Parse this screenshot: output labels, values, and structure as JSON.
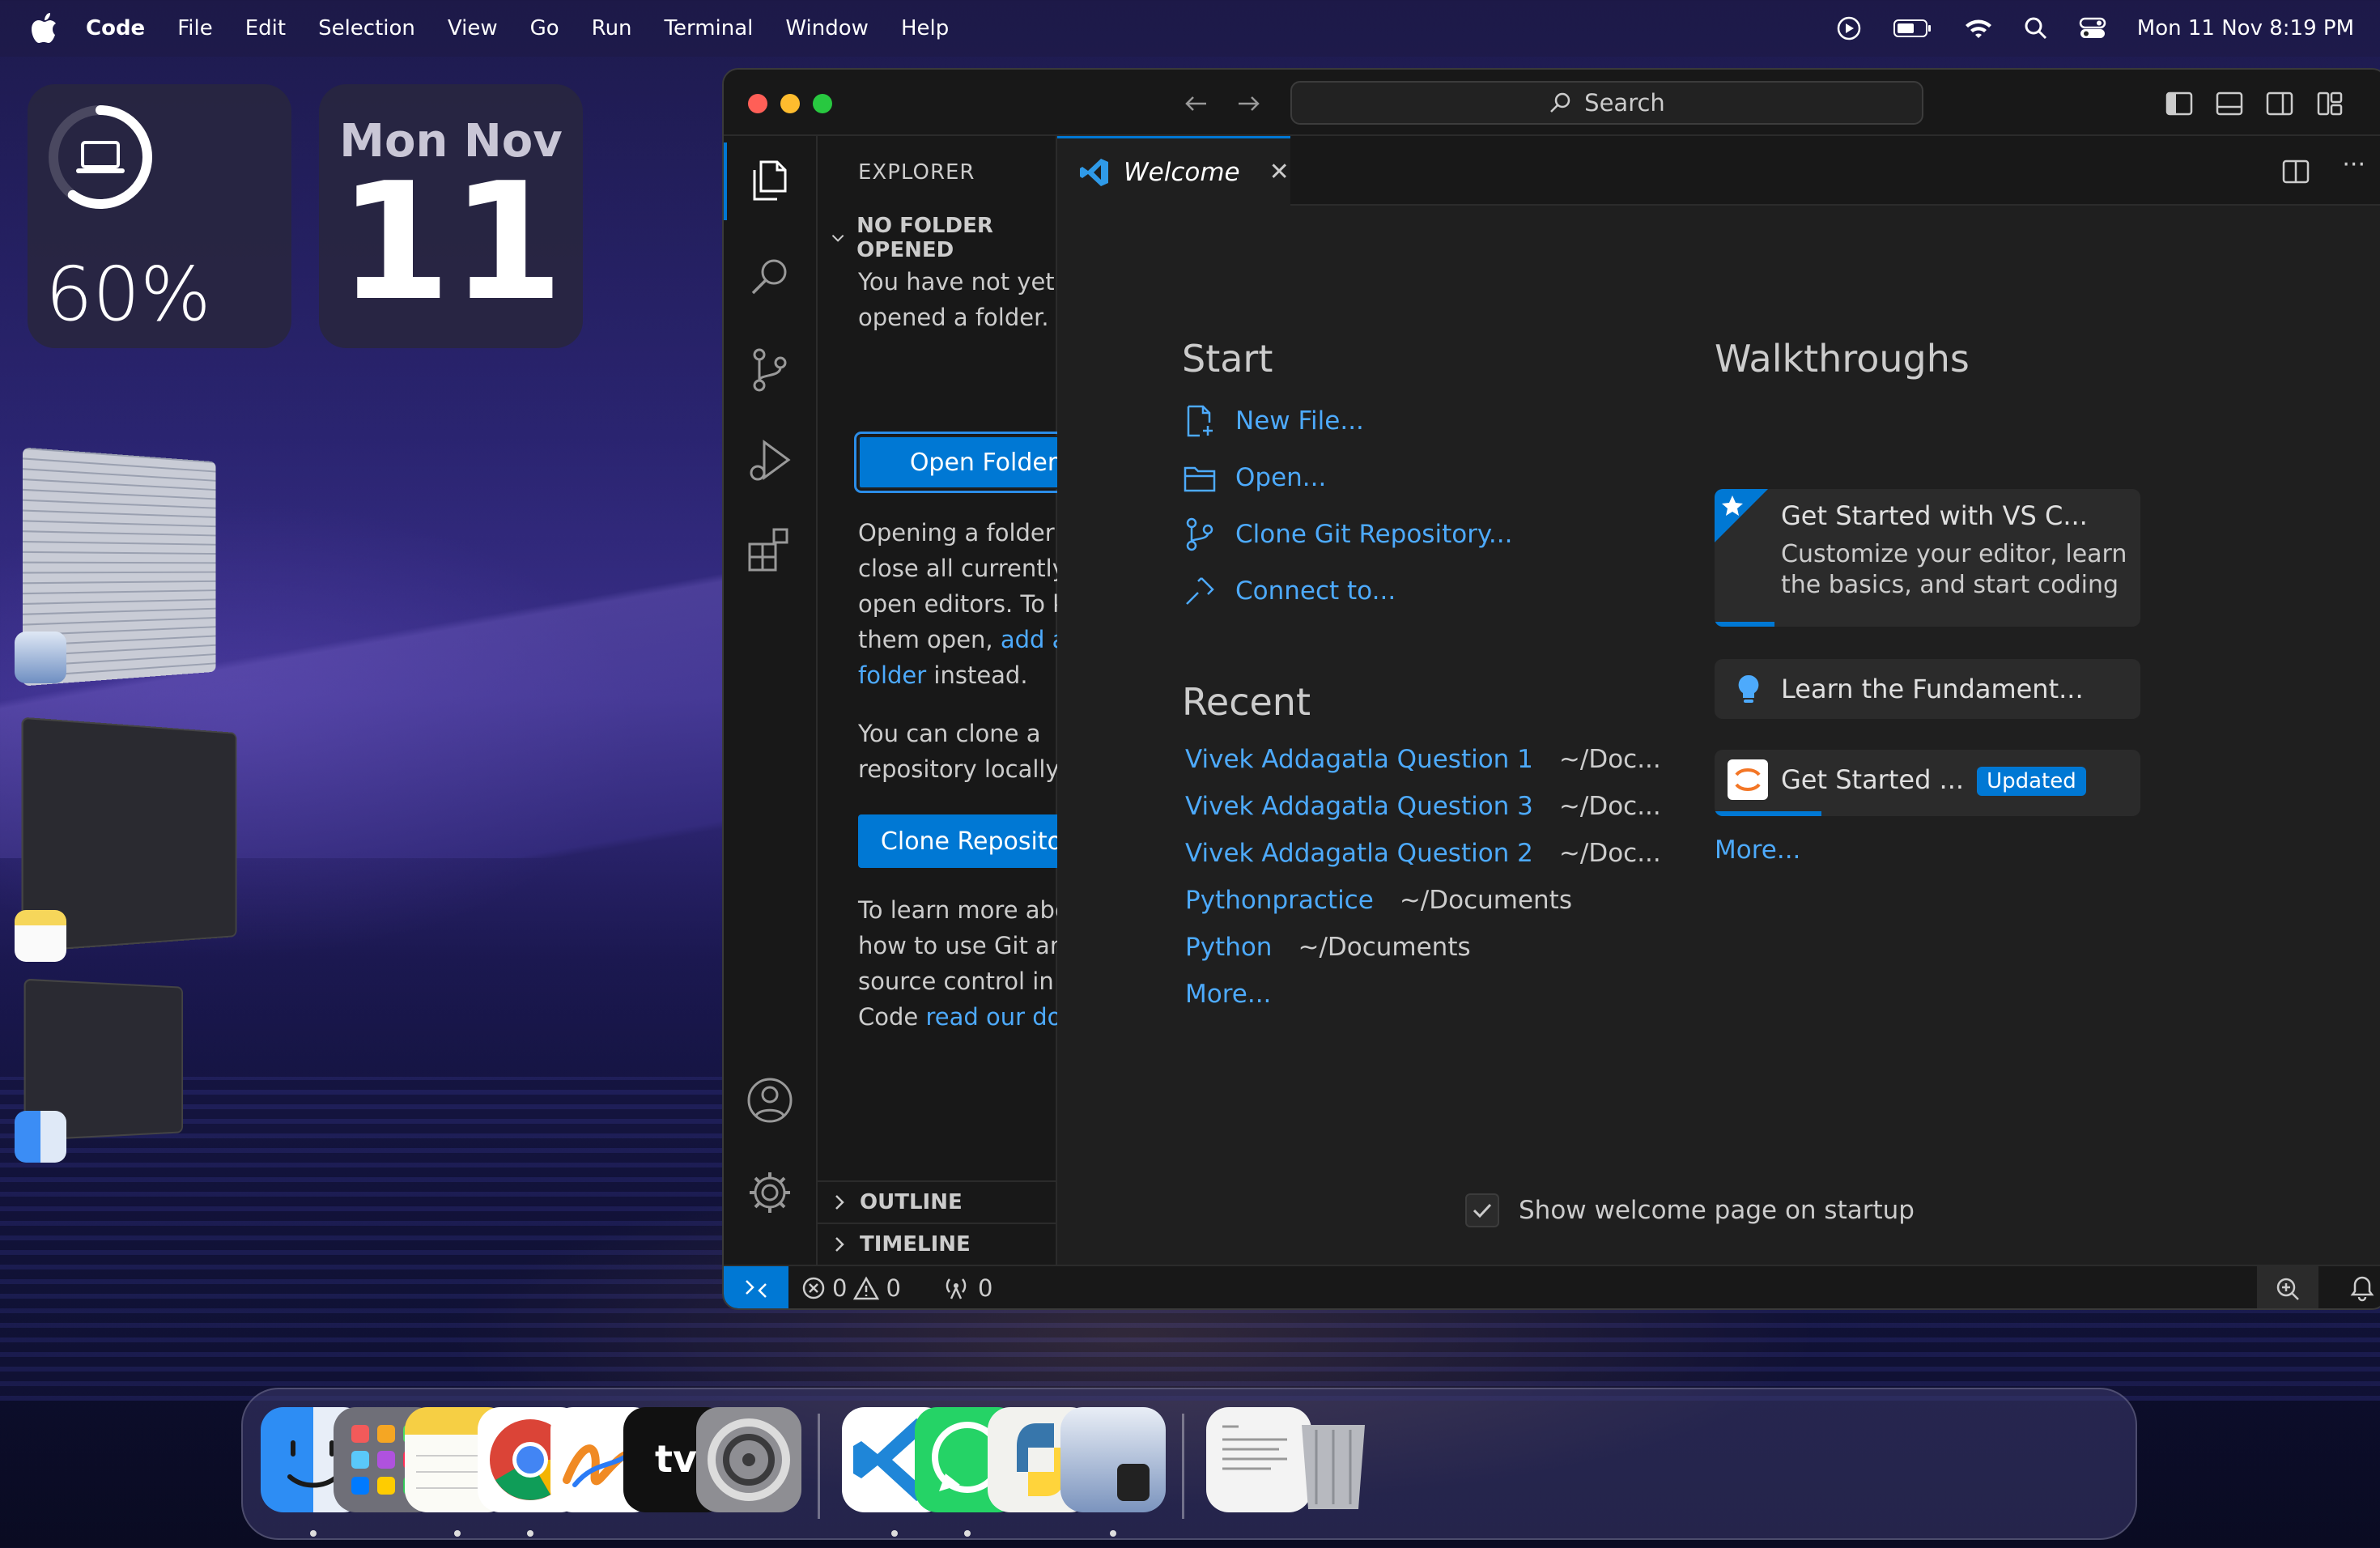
{
  "menubar": {
    "app_name": "Code",
    "menus": [
      "File",
      "Edit",
      "Selection",
      "View",
      "Go",
      "Run",
      "Terminal",
      "Window",
      "Help"
    ],
    "clock": "Mon 11 Nov  8:19 PM"
  },
  "widgets": {
    "battery": {
      "percent_label": "60%",
      "level": 0.6
    },
    "calendar": {
      "weekday_month": "Mon Nov",
      "day": "11"
    }
  },
  "vscode": {
    "search_label": "Search",
    "sidebar": {
      "title": "EXPLORER",
      "more": "···",
      "section_no_folder": "NO FOLDER OPENED",
      "text_not_opened": "You have not yet opened a folder.",
      "open_folder_button": "Open Folder",
      "text_opening_1": "Opening a folder will close all currently open editors. To keep them open,",
      "link_add_folder": "add a folder",
      "text_opening_2": "instead.",
      "text_clone": "You can clone a repository locally.",
      "clone_button": "Clone Repository",
      "text_learn_1": "To learn more about how to use Git and source control in VS Code",
      "link_docs": "read our docs",
      "text_learn_2": ".",
      "section_outline": "OUTLINE",
      "section_timeline": "TIMELINE"
    },
    "tab": {
      "label": "Welcome",
      "close": "✕"
    },
    "welcome": {
      "start_heading": "Start",
      "start_items": [
        {
          "label": "New File...",
          "icon": "new-file-icon"
        },
        {
          "label": "Open...",
          "icon": "folder-icon"
        },
        {
          "label": "Clone Git Repository...",
          "icon": "git-branch-icon"
        },
        {
          "label": "Connect to...",
          "icon": "remote-icon"
        }
      ],
      "recent_heading": "Recent",
      "recent": [
        {
          "name": "Vivek Addagatla Question 1",
          "path": "~/Doc..."
        },
        {
          "name": "Vivek Addagatla Question 3",
          "path": "~/Doc..."
        },
        {
          "name": "Vivek Addagatla Question 2",
          "path": "~/Doc..."
        },
        {
          "name": "Pythonpractice",
          "path": "~/Documents"
        },
        {
          "name": "Python",
          "path": "~/Documents"
        }
      ],
      "recent_more": "More...",
      "walkthroughs_heading": "Walkthroughs",
      "walkthroughs": [
        {
          "title": "Get Started with VS C...",
          "description": "Customize your editor, learn the basics, and start coding",
          "progress": 0.14
        },
        {
          "title": "Learn the Fundament...",
          "progress": 0
        },
        {
          "title": "Get Started ...",
          "badge": "Updated",
          "progress": 0.25
        }
      ],
      "walkthroughs_more": "More...",
      "show_on_startup": "Show welcome page on startup",
      "show_on_startup_checked": true
    },
    "statusbar": {
      "errors": "0",
      "warnings": "0",
      "ports": "0"
    }
  },
  "dock": {
    "apps": [
      "Finder",
      "Launchpad",
      "Notes",
      "Google Chrome",
      "Freeform",
      "Apple TV",
      "System Settings",
      "Visual Studio Code",
      "WhatsApp",
      "Python Launcher",
      "Preview",
      "Documents",
      "Trash"
    ]
  },
  "colors": {
    "accent": "#0078d4",
    "link": "#4daafc",
    "editor_bg": "#1f1f1f",
    "sidebar_bg": "#181818"
  }
}
